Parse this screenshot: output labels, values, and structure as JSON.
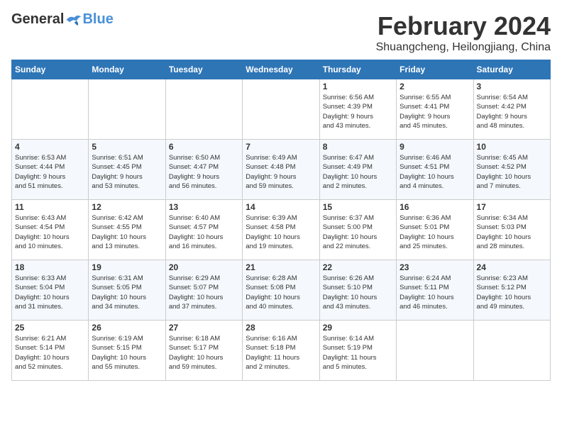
{
  "logo": {
    "general": "General",
    "blue": "Blue"
  },
  "title": {
    "month": "February 2024",
    "location": "Shuangcheng, Heilongjiang, China"
  },
  "headers": [
    "Sunday",
    "Monday",
    "Tuesday",
    "Wednesday",
    "Thursday",
    "Friday",
    "Saturday"
  ],
  "weeks": [
    [
      {
        "day": "",
        "info": ""
      },
      {
        "day": "",
        "info": ""
      },
      {
        "day": "",
        "info": ""
      },
      {
        "day": "",
        "info": ""
      },
      {
        "day": "1",
        "info": "Sunrise: 6:56 AM\nSunset: 4:39 PM\nDaylight: 9 hours\nand 43 minutes."
      },
      {
        "day": "2",
        "info": "Sunrise: 6:55 AM\nSunset: 4:41 PM\nDaylight: 9 hours\nand 45 minutes."
      },
      {
        "day": "3",
        "info": "Sunrise: 6:54 AM\nSunset: 4:42 PM\nDaylight: 9 hours\nand 48 minutes."
      }
    ],
    [
      {
        "day": "4",
        "info": "Sunrise: 6:53 AM\nSunset: 4:44 PM\nDaylight: 9 hours\nand 51 minutes."
      },
      {
        "day": "5",
        "info": "Sunrise: 6:51 AM\nSunset: 4:45 PM\nDaylight: 9 hours\nand 53 minutes."
      },
      {
        "day": "6",
        "info": "Sunrise: 6:50 AM\nSunset: 4:47 PM\nDaylight: 9 hours\nand 56 minutes."
      },
      {
        "day": "7",
        "info": "Sunrise: 6:49 AM\nSunset: 4:48 PM\nDaylight: 9 hours\nand 59 minutes."
      },
      {
        "day": "8",
        "info": "Sunrise: 6:47 AM\nSunset: 4:49 PM\nDaylight: 10 hours\nand 2 minutes."
      },
      {
        "day": "9",
        "info": "Sunrise: 6:46 AM\nSunset: 4:51 PM\nDaylight: 10 hours\nand 4 minutes."
      },
      {
        "day": "10",
        "info": "Sunrise: 6:45 AM\nSunset: 4:52 PM\nDaylight: 10 hours\nand 7 minutes."
      }
    ],
    [
      {
        "day": "11",
        "info": "Sunrise: 6:43 AM\nSunset: 4:54 PM\nDaylight: 10 hours\nand 10 minutes."
      },
      {
        "day": "12",
        "info": "Sunrise: 6:42 AM\nSunset: 4:55 PM\nDaylight: 10 hours\nand 13 minutes."
      },
      {
        "day": "13",
        "info": "Sunrise: 6:40 AM\nSunset: 4:57 PM\nDaylight: 10 hours\nand 16 minutes."
      },
      {
        "day": "14",
        "info": "Sunrise: 6:39 AM\nSunset: 4:58 PM\nDaylight: 10 hours\nand 19 minutes."
      },
      {
        "day": "15",
        "info": "Sunrise: 6:37 AM\nSunset: 5:00 PM\nDaylight: 10 hours\nand 22 minutes."
      },
      {
        "day": "16",
        "info": "Sunrise: 6:36 AM\nSunset: 5:01 PM\nDaylight: 10 hours\nand 25 minutes."
      },
      {
        "day": "17",
        "info": "Sunrise: 6:34 AM\nSunset: 5:03 PM\nDaylight: 10 hours\nand 28 minutes."
      }
    ],
    [
      {
        "day": "18",
        "info": "Sunrise: 6:33 AM\nSunset: 5:04 PM\nDaylight: 10 hours\nand 31 minutes."
      },
      {
        "day": "19",
        "info": "Sunrise: 6:31 AM\nSunset: 5:05 PM\nDaylight: 10 hours\nand 34 minutes."
      },
      {
        "day": "20",
        "info": "Sunrise: 6:29 AM\nSunset: 5:07 PM\nDaylight: 10 hours\nand 37 minutes."
      },
      {
        "day": "21",
        "info": "Sunrise: 6:28 AM\nSunset: 5:08 PM\nDaylight: 10 hours\nand 40 minutes."
      },
      {
        "day": "22",
        "info": "Sunrise: 6:26 AM\nSunset: 5:10 PM\nDaylight: 10 hours\nand 43 minutes."
      },
      {
        "day": "23",
        "info": "Sunrise: 6:24 AM\nSunset: 5:11 PM\nDaylight: 10 hours\nand 46 minutes."
      },
      {
        "day": "24",
        "info": "Sunrise: 6:23 AM\nSunset: 5:12 PM\nDaylight: 10 hours\nand 49 minutes."
      }
    ],
    [
      {
        "day": "25",
        "info": "Sunrise: 6:21 AM\nSunset: 5:14 PM\nDaylight: 10 hours\nand 52 minutes."
      },
      {
        "day": "26",
        "info": "Sunrise: 6:19 AM\nSunset: 5:15 PM\nDaylight: 10 hours\nand 55 minutes."
      },
      {
        "day": "27",
        "info": "Sunrise: 6:18 AM\nSunset: 5:17 PM\nDaylight: 10 hours\nand 59 minutes."
      },
      {
        "day": "28",
        "info": "Sunrise: 6:16 AM\nSunset: 5:18 PM\nDaylight: 11 hours\nand 2 minutes."
      },
      {
        "day": "29",
        "info": "Sunrise: 6:14 AM\nSunset: 5:19 PM\nDaylight: 11 hours\nand 5 minutes."
      },
      {
        "day": "",
        "info": ""
      },
      {
        "day": "",
        "info": ""
      }
    ]
  ]
}
